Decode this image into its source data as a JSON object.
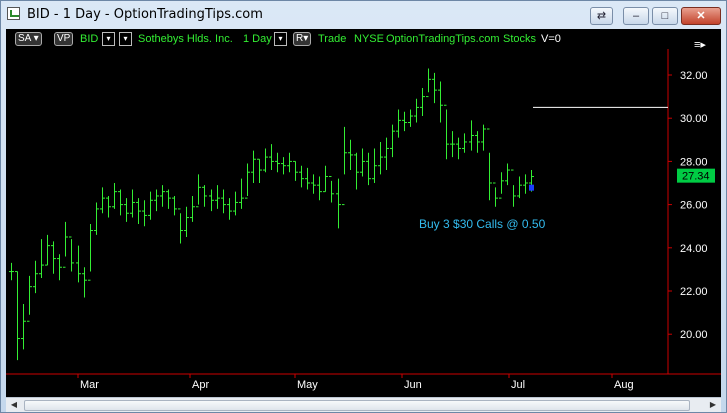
{
  "window": {
    "title": "BID - 1 Day - OptionTradingTips.com",
    "buttons": {
      "restore": "⇄",
      "minimize": "‒",
      "maximize": "□",
      "close": "✕"
    }
  },
  "symbol_bar": {
    "sa": "SA",
    "vp": "VP",
    "symbol": "BID",
    "company": "Sothebys Hlds. Inc.",
    "interval": "1 Day",
    "r_button": "R",
    "feed": "Trade",
    "exchange": "NYSE",
    "source": "OptionTradingTips.com",
    "type": "Stocks",
    "volume": "V=0"
  },
  "colors": {
    "bars": "#33ee33",
    "axis": "#cc0000",
    "annotation": "#33bbee",
    "price_tag": "#00cc44",
    "marker": "#1a3cff"
  },
  "chart_data": {
    "type": "ohlc",
    "y_ticks": [
      "20.00",
      "22.00",
      "24.00",
      "26.00",
      "28.00",
      "30.00",
      "32.00"
    ],
    "y_min": 18.0,
    "y_max": 34.0,
    "x_ticks": [
      "Mar",
      "Apr",
      "May",
      "Jun",
      "Jul",
      "Aug"
    ],
    "last_price": "27.34",
    "annotation": "Buy 3 $30 Calls @ 0.50",
    "reference_line_value": 30.5,
    "bars": [
      [
        23.3,
        22.5,
        22.9
      ],
      [
        22.9,
        18.8,
        19.8
      ],
      [
        21.4,
        19.3,
        20.6
      ],
      [
        22.7,
        20.9,
        22.2
      ],
      [
        23.4,
        21.9,
        22.8
      ],
      [
        24.4,
        22.6,
        23.2
      ],
      [
        24.6,
        23.2,
        24.1
      ],
      [
        24.3,
        22.8,
        23.5
      ],
      [
        23.7,
        22.5,
        23.1
      ],
      [
        25.2,
        23.6,
        24.5
      ],
      [
        24.4,
        22.9,
        23.3
      ],
      [
        24.1,
        22.4,
        22.8
      ],
      [
        23.1,
        21.7,
        22.5
      ],
      [
        25.1,
        22.9,
        24.8
      ],
      [
        26.1,
        24.6,
        25.8
      ],
      [
        26.8,
        25.6,
        26.3
      ],
      [
        26.4,
        25.4,
        25.9
      ],
      [
        27.0,
        25.8,
        26.6
      ],
      [
        26.7,
        25.5,
        26.0
      ],
      [
        26.3,
        25.2,
        25.6
      ],
      [
        26.7,
        25.4,
        26.1
      ],
      [
        26.3,
        25.1,
        25.7
      ],
      [
        26.2,
        25.0,
        25.5
      ],
      [
        26.6,
        25.3,
        26.2
      ],
      [
        26.7,
        25.7,
        26.4
      ],
      [
        26.9,
        25.9,
        26.6
      ],
      [
        26.7,
        25.8,
        26.3
      ],
      [
        26.4,
        25.5,
        25.8
      ],
      [
        25.6,
        24.2,
        24.8
      ],
      [
        25.9,
        24.5,
        25.4
      ],
      [
        26.4,
        25.2,
        25.9
      ],
      [
        27.4,
        26.0,
        26.8
      ],
      [
        26.9,
        25.9,
        26.4
      ],
      [
        26.7,
        25.7,
        26.2
      ],
      [
        26.9,
        25.8,
        26.3
      ],
      [
        26.7,
        25.6,
        26.0
      ],
      [
        26.3,
        25.3,
        25.7
      ],
      [
        26.6,
        25.5,
        26.1
      ],
      [
        27.2,
        25.8,
        26.3
      ],
      [
        27.9,
        26.4,
        27.5
      ],
      [
        28.5,
        27.0,
        28.1
      ],
      [
        28.1,
        27.0,
        27.6
      ],
      [
        28.6,
        27.5,
        28.2
      ],
      [
        28.8,
        27.6,
        28.0
      ],
      [
        28.4,
        27.5,
        27.9
      ],
      [
        28.2,
        27.4,
        27.8
      ],
      [
        28.4,
        27.5,
        28.0
      ],
      [
        28.0,
        27.1,
        27.5
      ],
      [
        27.8,
        26.8,
        27.2
      ],
      [
        27.7,
        26.7,
        27.0
      ],
      [
        27.4,
        26.5,
        26.9
      ],
      [
        27.3,
        26.2,
        26.6
      ],
      [
        27.8,
        26.6,
        27.3
      ],
      [
        27.1,
        26.1,
        26.5
      ],
      [
        27.2,
        24.9,
        26.0
      ],
      [
        29.6,
        27.4,
        28.4
      ],
      [
        29.0,
        27.6,
        28.3
      ],
      [
        28.4,
        26.7,
        27.5
      ],
      [
        28.6,
        27.3,
        28.0
      ],
      [
        28.4,
        26.9,
        27.2
      ],
      [
        28.6,
        27.0,
        27.8
      ],
      [
        28.9,
        27.4,
        28.2
      ],
      [
        29.1,
        27.6,
        28.6
      ],
      [
        29.7,
        28.2,
        29.4
      ],
      [
        30.4,
        29.1,
        29.9
      ],
      [
        30.3,
        29.4,
        29.8
      ],
      [
        30.4,
        29.6,
        30.1
      ],
      [
        30.9,
        29.8,
        30.5
      ],
      [
        31.4,
        30.1,
        31.0
      ],
      [
        32.3,
        31.2,
        31.8
      ],
      [
        32.1,
        30.7,
        31.3
      ],
      [
        31.7,
        29.8,
        30.6
      ],
      [
        30.4,
        28.1,
        28.8
      ],
      [
        29.4,
        28.2,
        28.8
      ],
      [
        29.1,
        28.1,
        28.6
      ],
      [
        29.3,
        28.4,
        28.9
      ],
      [
        29.9,
        28.5,
        29.2
      ],
      [
        29.4,
        28.4,
        28.9
      ],
      [
        29.7,
        28.5,
        29.5
      ],
      [
        28.4,
        26.2,
        27.0
      ],
      [
        26.8,
        25.9,
        26.3
      ],
      [
        27.5,
        26.5,
        27.1
      ],
      [
        27.9,
        26.9,
        27.6
      ],
      [
        26.9,
        25.9,
        26.4
      ],
      [
        27.3,
        26.3,
        26.9
      ],
      [
        27.4,
        26.5,
        27.0
      ],
      [
        27.6,
        26.6,
        27.3
      ]
    ]
  }
}
